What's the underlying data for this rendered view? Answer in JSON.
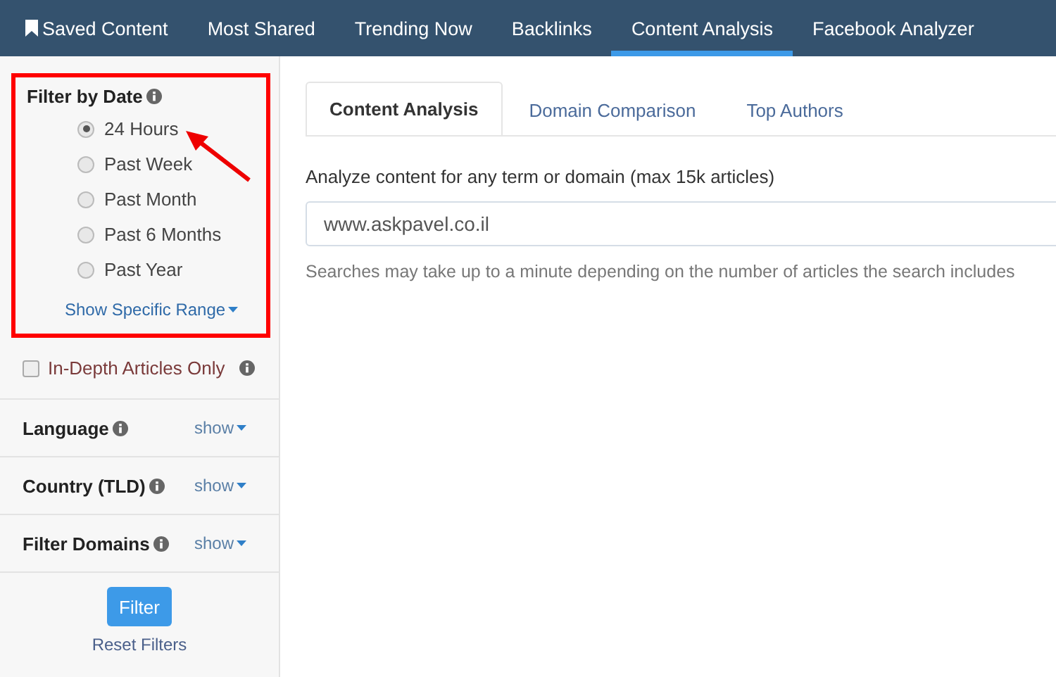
{
  "nav": {
    "items": [
      {
        "label": "Saved Content",
        "selected": false
      },
      {
        "label": "Most Shared",
        "selected": false
      },
      {
        "label": "Trending Now",
        "selected": false
      },
      {
        "label": "Backlinks",
        "selected": false
      },
      {
        "label": "Content Analysis",
        "selected": true
      },
      {
        "label": "Facebook Analyzer",
        "selected": false
      }
    ]
  },
  "sidebar": {
    "date_filter": {
      "title": "Filter by Date",
      "highlighted": true,
      "options": [
        {
          "label": "24 Hours",
          "selected": true,
          "pointed": true
        },
        {
          "label": "Past Week",
          "selected": false,
          "pointed": false
        },
        {
          "label": "Past Month",
          "selected": false,
          "pointed": false
        },
        {
          "label": "Past 6 Months",
          "selected": false,
          "pointed": false
        },
        {
          "label": "Past Year",
          "selected": false,
          "pointed": false
        }
      ],
      "range_link": "Show Specific Range"
    },
    "in_depth": {
      "label": "In-Depth Articles Only",
      "checked": false
    },
    "sections": [
      {
        "title": "Language",
        "toggle": "show"
      },
      {
        "title": "Country (TLD)",
        "toggle": "show"
      },
      {
        "title": "Filter Domains",
        "toggle": "show"
      }
    ],
    "filter_button": "Filter",
    "reset_link": "Reset Filters"
  },
  "main": {
    "tabs": [
      {
        "label": "Content Analysis",
        "selected": true
      },
      {
        "label": "Domain Comparison",
        "selected": false
      },
      {
        "label": "Top Authors",
        "selected": false
      }
    ],
    "prompt": "Analyze content for any term or domain (max 15k articles)",
    "search": {
      "value": "www.askpavel.co.il"
    },
    "hint": "Searches may take up to a minute depending on the number of articles the search includes"
  }
}
